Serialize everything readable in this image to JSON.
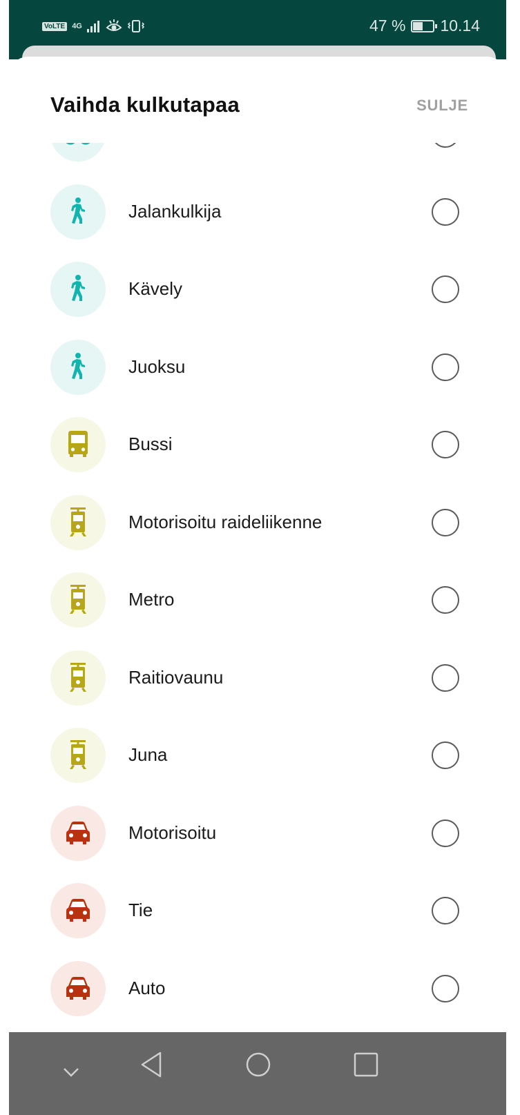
{
  "status_bar": {
    "volte": "VoLTE",
    "network": "4G",
    "battery_percent": "47 %",
    "battery_level": 0.47,
    "time": "10.14"
  },
  "sheet": {
    "title": "Vaihda kulkutapaa",
    "close_label": "SULJE"
  },
  "colors": {
    "status_bar": "#05463e",
    "walk_icon": "#12b5ad",
    "walk_bg": "#e6f6f5",
    "transit_icon": "#b7a716",
    "transit_bg": "#f6f7e4",
    "car_icon": "#b9320f",
    "car_bg": "#f9e8e3",
    "nav_bar": "#666666"
  },
  "modes": [
    {
      "label": "",
      "icon": "bike-icon",
      "category": "walk"
    },
    {
      "label": "Jalankulkija",
      "icon": "pedestrian-icon",
      "category": "walk"
    },
    {
      "label": "Kävely",
      "icon": "pedestrian-icon",
      "category": "walk"
    },
    {
      "label": "Juoksu",
      "icon": "pedestrian-icon",
      "category": "walk"
    },
    {
      "label": "Bussi",
      "icon": "bus-icon",
      "category": "transit"
    },
    {
      "label": "Motorisoitu raideliikenne",
      "icon": "tram-icon",
      "category": "transit"
    },
    {
      "label": "Metro",
      "icon": "tram-icon",
      "category": "transit"
    },
    {
      "label": "Raitiovaunu",
      "icon": "tram-icon",
      "category": "transit"
    },
    {
      "label": "Juna",
      "icon": "tram-icon",
      "category": "transit"
    },
    {
      "label": "Motorisoitu",
      "icon": "car-icon",
      "category": "car"
    },
    {
      "label": "Tie",
      "icon": "car-icon",
      "category": "car"
    },
    {
      "label": "Auto",
      "icon": "car-icon",
      "category": "car"
    }
  ],
  "nav_bar": {
    "buttons": [
      "collapse-icon",
      "back-icon",
      "home-icon",
      "recents-icon"
    ]
  }
}
